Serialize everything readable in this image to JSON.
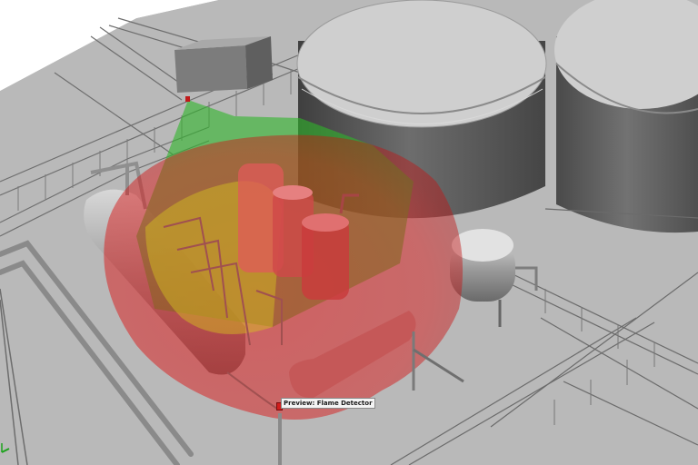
{
  "viewport": {
    "preview_label": "Preview: Flame Detector"
  },
  "colors": {
    "ground": "#b8b8b8",
    "background": "#ffffff",
    "coverage_red": "#e0191b",
    "coverage_green": "#2fb52a",
    "coverage_yellow": "#d6c61c",
    "tank": "#5a5a5a",
    "pipe": "#8f8f8f"
  },
  "scene_objects": {
    "detector_icon": "flame-detector-icon",
    "axis_icon": "axis-triad-icon"
  }
}
